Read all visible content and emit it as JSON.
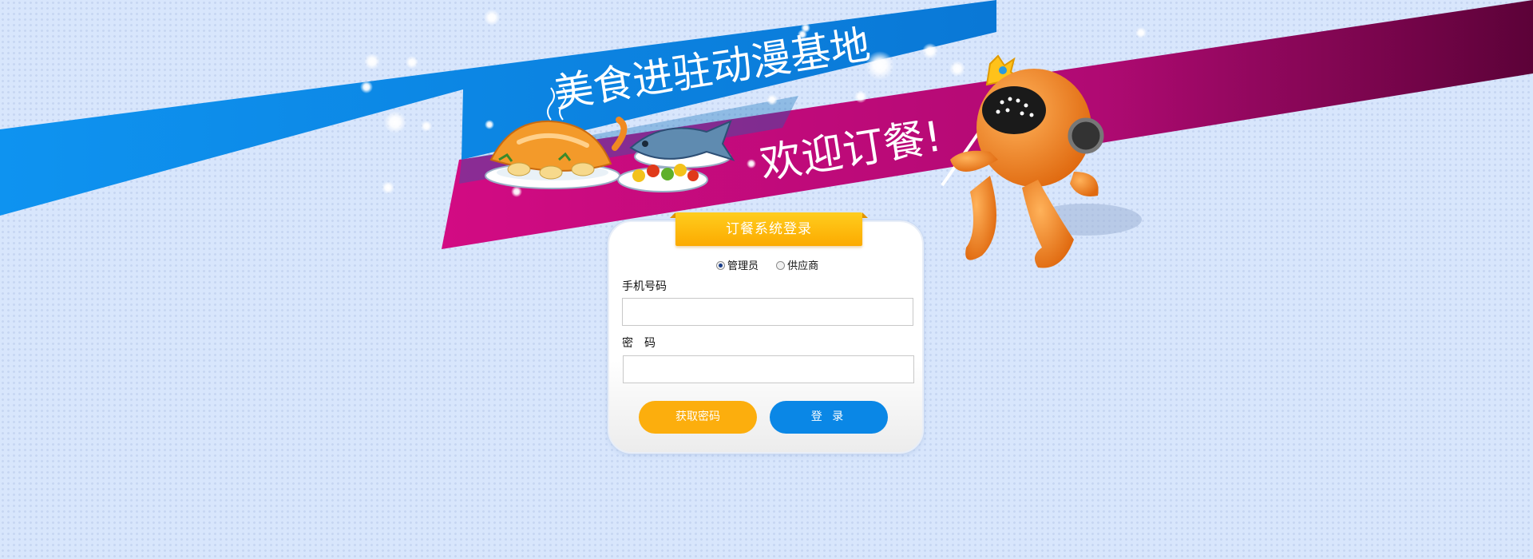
{
  "banner": {
    "headline": "美食进驻动漫基地",
    "welcome": "欢迎订餐!"
  },
  "login": {
    "title": "订餐系统登录",
    "roles": [
      {
        "label": "管理员",
        "checked": true
      },
      {
        "label": "供应商",
        "checked": false
      }
    ],
    "phone_label": "手机号码",
    "phone_value": "",
    "password_label": "密　码",
    "password_value": "",
    "get_password_label": "获取密码",
    "login_label": "登 录"
  },
  "colors": {
    "background": "#d8e6fc",
    "blue_ribbon": "#0b8ae4",
    "pink_ribbon": "#c8087a",
    "accent_orange": "#fcae0d",
    "accent_blue": "#0a87e6",
    "mascot": "#f08a22"
  },
  "icons": [
    "food-platter-icon",
    "mascot-character-icon",
    "radio-icon"
  ]
}
